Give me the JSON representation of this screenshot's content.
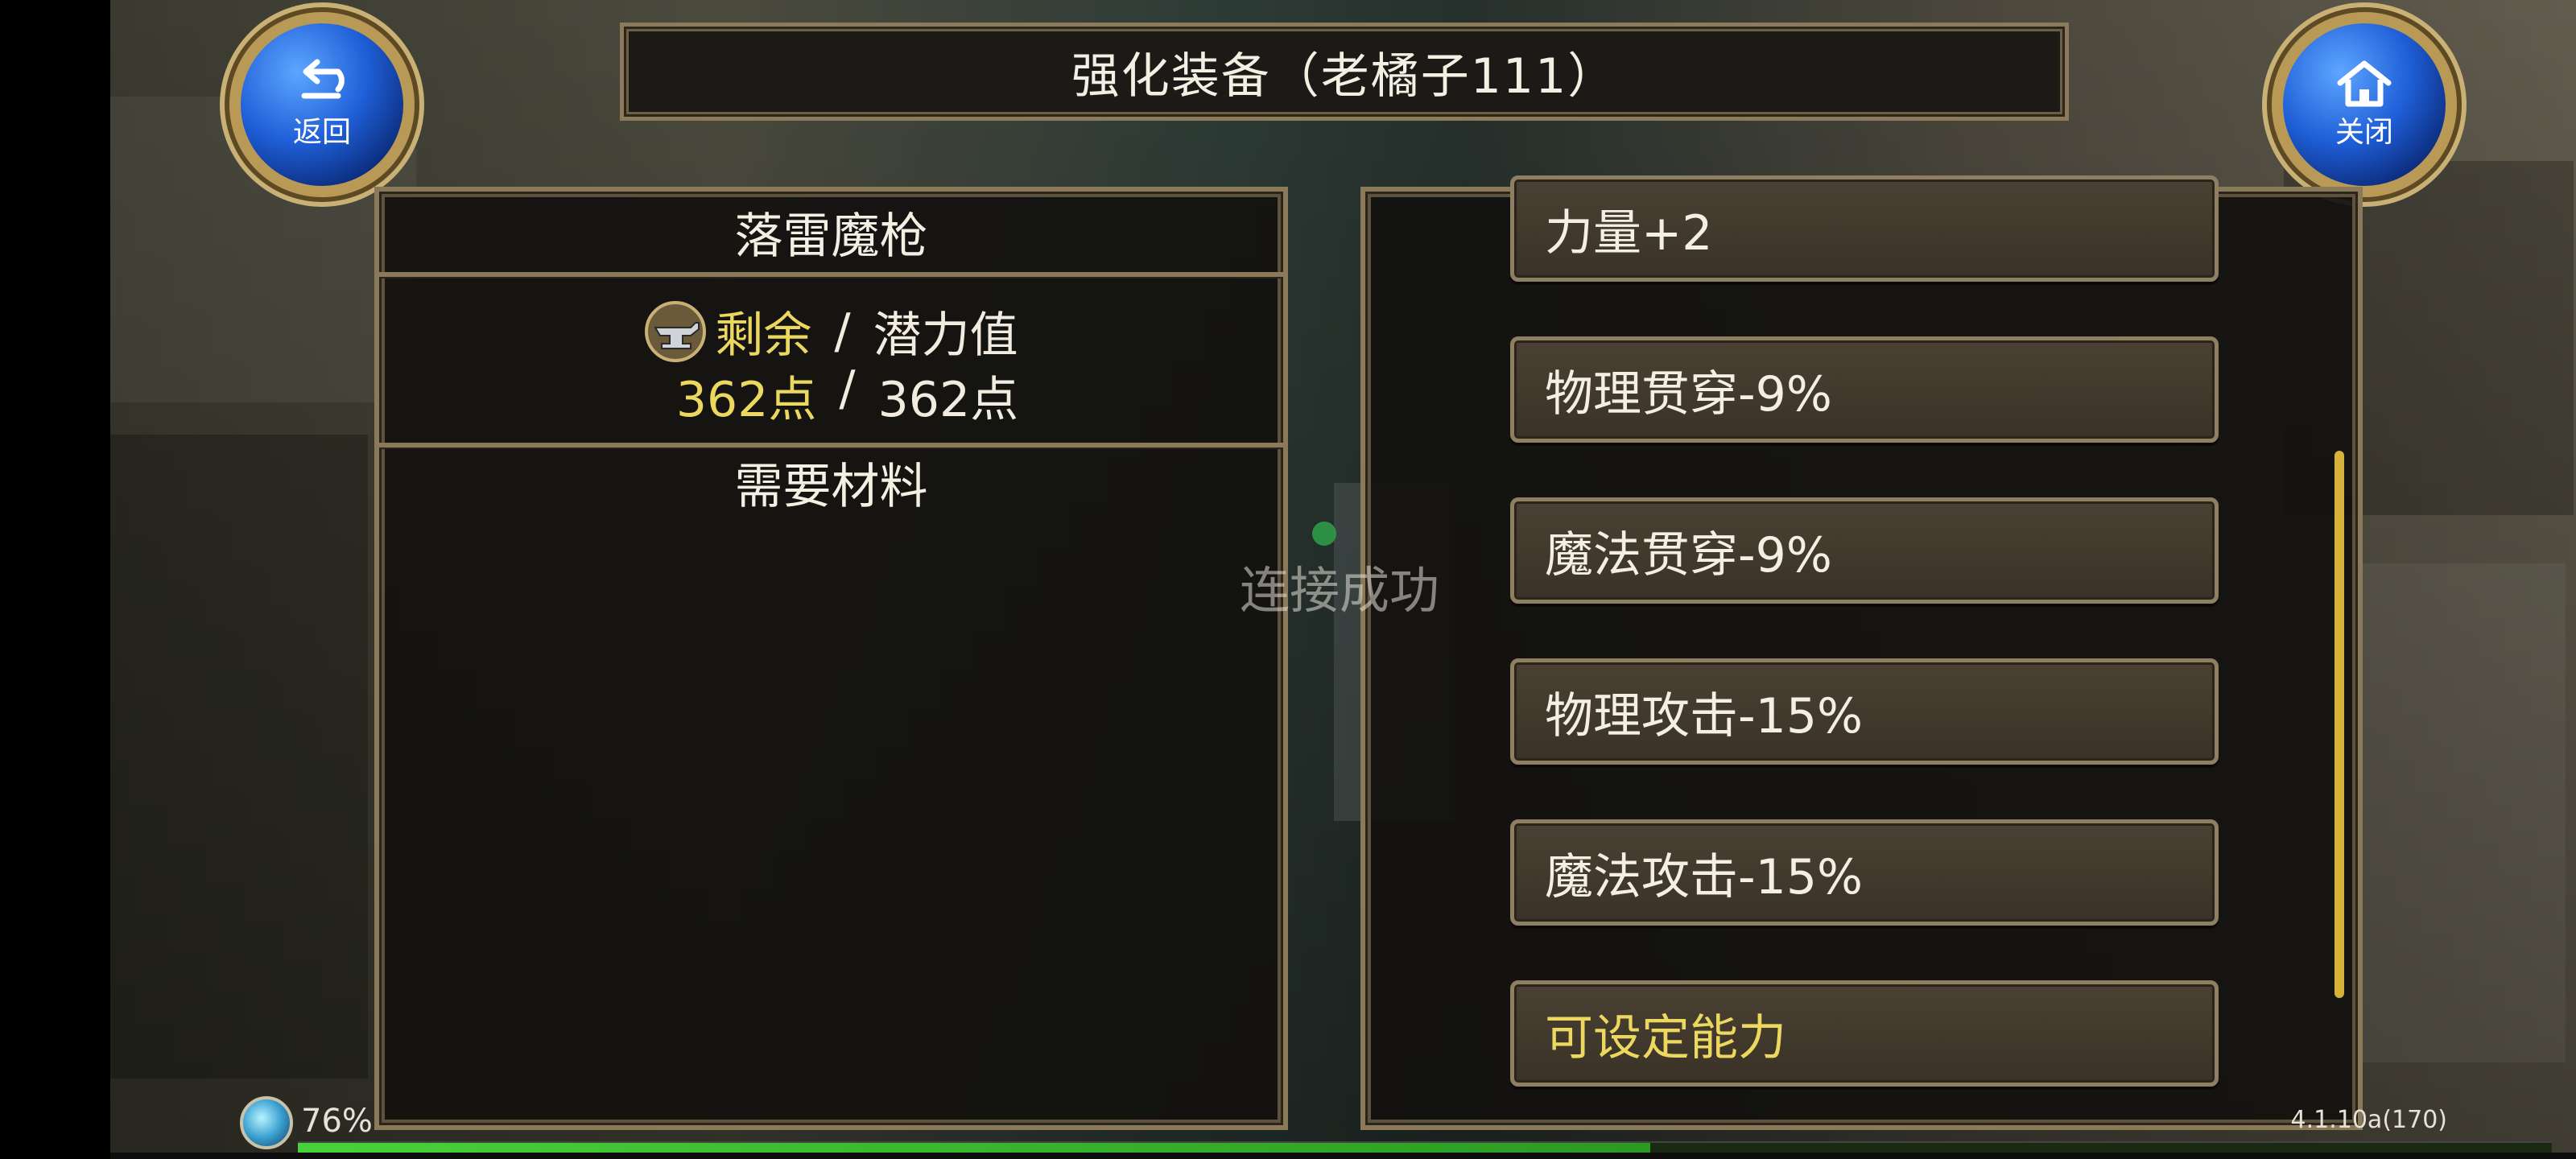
{
  "header": {
    "title": "强化装备（老橘子111）"
  },
  "buttons": {
    "back_label": "返回",
    "close_label": "关闭"
  },
  "left_panel": {
    "item_name": "落雷魔枪",
    "remaining_label": "剩余",
    "separator": "/",
    "potential_label": "潜力值",
    "remaining_value": "362点",
    "potential_value": "362点",
    "materials_title": "需要材料"
  },
  "stat_list": [
    {
      "label": "力量+2"
    },
    {
      "label": "物理贯穿-9%"
    },
    {
      "label": "魔法贯穿-9%"
    },
    {
      "label": "物理攻击-15%"
    },
    {
      "label": "魔法攻击-15%"
    },
    {
      "label": "可设定能力"
    }
  ],
  "toast": {
    "text": "连接成功"
  },
  "status": {
    "battery_percent": "76%",
    "version": "4.1.10a(170)",
    "exp_progress": 0.6
  },
  "colors": {
    "accent_yellow": "#ecd85e",
    "frame": "#8a7a5a",
    "button_blue": "#1f5fd8"
  }
}
